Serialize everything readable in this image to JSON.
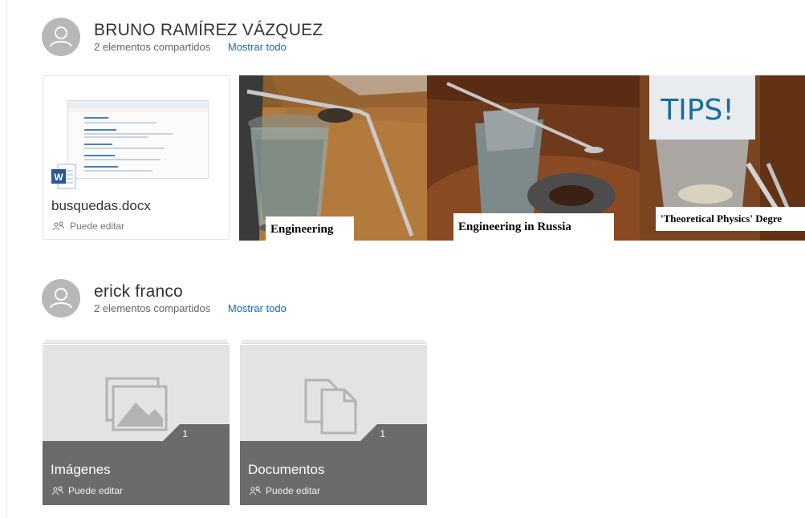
{
  "users": [
    {
      "name": "BRUNO RAMÍREZ VÁZQUEZ",
      "shared_count": "2 elementos compartidos",
      "show_all": "Mostrar todo",
      "document": {
        "name": "busquedas.docx",
        "permission": "Puede editar"
      },
      "photos": [
        {
          "caption": "Engineering"
        },
        {
          "caption": "Engineering in Russia"
        },
        {
          "caption": "'Theoretical Physics' Degre",
          "sign_text": "TIPS!"
        }
      ]
    },
    {
      "name": "erick franco",
      "shared_count": "2 elementos compartidos",
      "show_all": "Mostrar todo",
      "folders": [
        {
          "name": "Imágenes",
          "count": "1",
          "permission": "Puede editar",
          "icon": "image-icon"
        },
        {
          "name": "Documentos",
          "count": "1",
          "permission": "Puede editar",
          "icon": "documents-icon"
        }
      ]
    }
  ],
  "colors": {
    "link": "#0a6bc4",
    "avatar": "#b8b8b8",
    "folder_band": "#6b6b6b",
    "folder_body": "#e3e3e3"
  }
}
